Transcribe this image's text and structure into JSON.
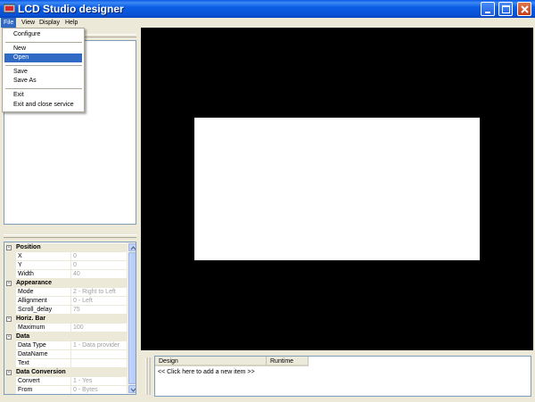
{
  "window": {
    "title": "LCD Studio designer"
  },
  "menubar": [
    "File",
    "View",
    "Display",
    "Help"
  ],
  "file_menu": {
    "configure": "Configure",
    "new": "New",
    "open": "Open",
    "save": "Save",
    "save_as": "Save As",
    "exit": "Exit",
    "exit_close": "Exit and close service"
  },
  "properties": {
    "position": {
      "label": "Position",
      "x_label": "X",
      "x": "0",
      "y_label": "Y",
      "y": "0",
      "width_label": "Width",
      "width": "40"
    },
    "appearance": {
      "label": "Appearance",
      "mode_label": "Mode",
      "mode": "2 - Right to Left",
      "align_label": "Allignment",
      "align": "0 - Left",
      "scroll_label": "Scroll_delay",
      "scroll": "75"
    },
    "hbar": {
      "label": "Horiz. Bar",
      "max_label": "Maximum",
      "max": "100"
    },
    "data": {
      "label": "Data",
      "type_label": "Data Type",
      "type": "1 - Data provider",
      "name_label": "DataName",
      "name": "",
      "text_label": "Text",
      "text": ""
    },
    "conversion": {
      "label": "Data Conversion",
      "convert_label": "Convert",
      "convert": "1 - Yes",
      "from_label": "From",
      "from": "0 - Bytes"
    }
  },
  "items_list": {
    "col_design": "Design",
    "col_runtime": "Runtime",
    "add_row": "<< Click here to add a new item >>"
  },
  "colors": {
    "title_bar": "#0a58e8",
    "menu_highlight": "#316ac5",
    "canvas": "#000000",
    "lcd_screen": "#ffffff"
  }
}
